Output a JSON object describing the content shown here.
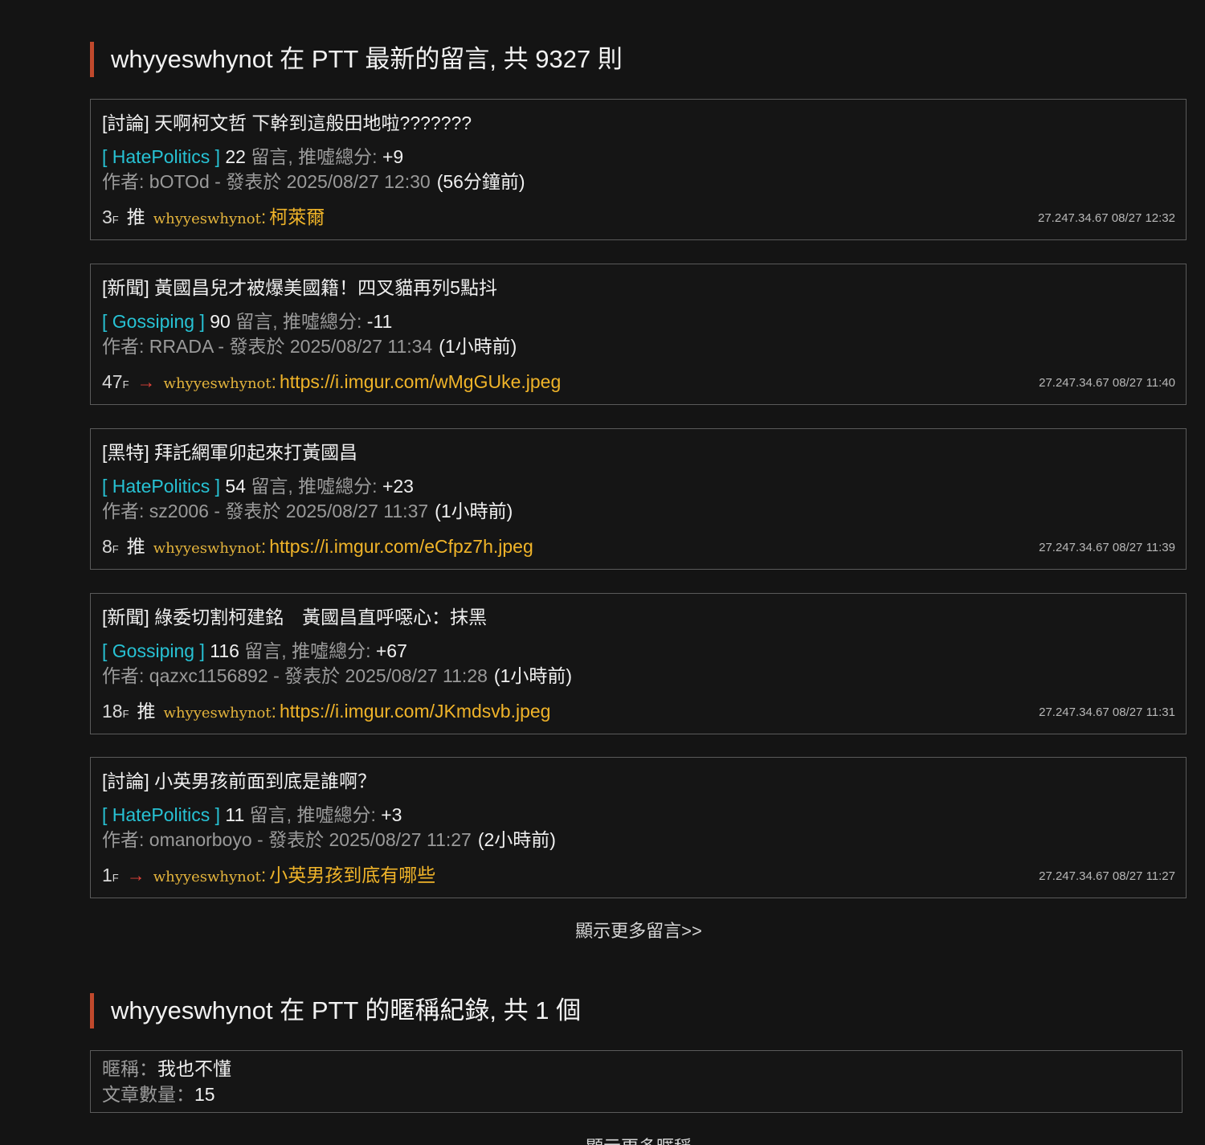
{
  "comments_section": {
    "user": "whyyeswhynot",
    "title_middle": " 在 PTT 最新的留言, 共 ",
    "count": "9327",
    "title_suffix": " 則"
  },
  "labels": {
    "comments_unit": " 留言, 推噓總分: ",
    "author_prefix": "作者: ",
    "posted_at": " - 發表於 ",
    "floor_suffix": "F",
    "push": "推",
    "arrow": "→",
    "colon": ":"
  },
  "posts": [
    {
      "title": "[討論] 天啊柯文哲 下幹到這般田地啦???????",
      "board": "[ HatePolitics ]",
      "comments": "22",
      "score": "+9",
      "author": "bOTOd",
      "datetime": "2025/08/27 12:30",
      "ago": "(56分鐘前)",
      "floor": "3",
      "tag": "推",
      "reply_user": "whyyeswhynot",
      "reply_text": "柯萊爾",
      "ip_date": "27.247.34.67 08/27 12:32"
    },
    {
      "title": "[新聞] 黃國昌兒才被爆美國籍！四叉貓再列5點抖",
      "board": "[ Gossiping ]",
      "comments": "90",
      "score": "-11",
      "author": "RRADA",
      "datetime": "2025/08/27 11:34",
      "ago": "(1小時前)",
      "floor": "47",
      "tag": "→",
      "reply_user": "whyyeswhynot",
      "reply_text": "https://i.imgur.com/wMgGUke.jpeg",
      "ip_date": "27.247.34.67 08/27 11:40"
    },
    {
      "title": "[黑特] 拜託網軍卯起來打黃國昌",
      "board": "[ HatePolitics ]",
      "comments": "54",
      "score": "+23",
      "author": "sz2006",
      "datetime": "2025/08/27 11:37",
      "ago": "(1小時前)",
      "floor": "8",
      "tag": "推",
      "reply_user": "whyyeswhynot",
      "reply_text": "https://i.imgur.com/eCfpz7h.jpeg",
      "ip_date": "27.247.34.67 08/27 11:39"
    },
    {
      "title": "[新聞] 綠委切割柯建銘　黃國昌直呼噁心：抹黑",
      "board": "[ Gossiping ]",
      "comments": "116",
      "score": "+67",
      "author": "qazxc1156892",
      "datetime": "2025/08/27 11:28",
      "ago": "(1小時前)",
      "floor": "18",
      "tag": "推",
      "reply_user": "whyyeswhynot",
      "reply_text": "https://i.imgur.com/JKmdsvb.jpeg",
      "ip_date": "27.247.34.67 08/27 11:31"
    },
    {
      "title": "[討論] 小英男孩前面到底是誰啊？",
      "board": "[ HatePolitics ]",
      "comments": "11",
      "score": "+3",
      "author": "omanorboyo",
      "datetime": "2025/08/27 11:27",
      "ago": "(2小時前)",
      "floor": "1",
      "tag": "→",
      "reply_user": "whyyeswhynot",
      "reply_text": "小英男孩到底有哪些",
      "ip_date": "27.247.34.67 08/27 11:27"
    }
  ],
  "show_more_comments": "顯示更多留言>>",
  "nickname_section": {
    "user": "whyyeswhynot",
    "title_middle": " 在 PTT 的暱稱紀錄, 共 ",
    "count": "1",
    "title_suffix": " 個",
    "nick_label": "暱稱：",
    "nick_value": "我也不懂",
    "articles_label": "文章數量：",
    "articles_value": "15"
  },
  "show_more_nicknames": "顯示更多暱稱",
  "colors": {
    "accent_bar": "#c0492c",
    "board": "#27c2d4",
    "reply_text": "#f0b429",
    "arrow": "#e0433a"
  }
}
